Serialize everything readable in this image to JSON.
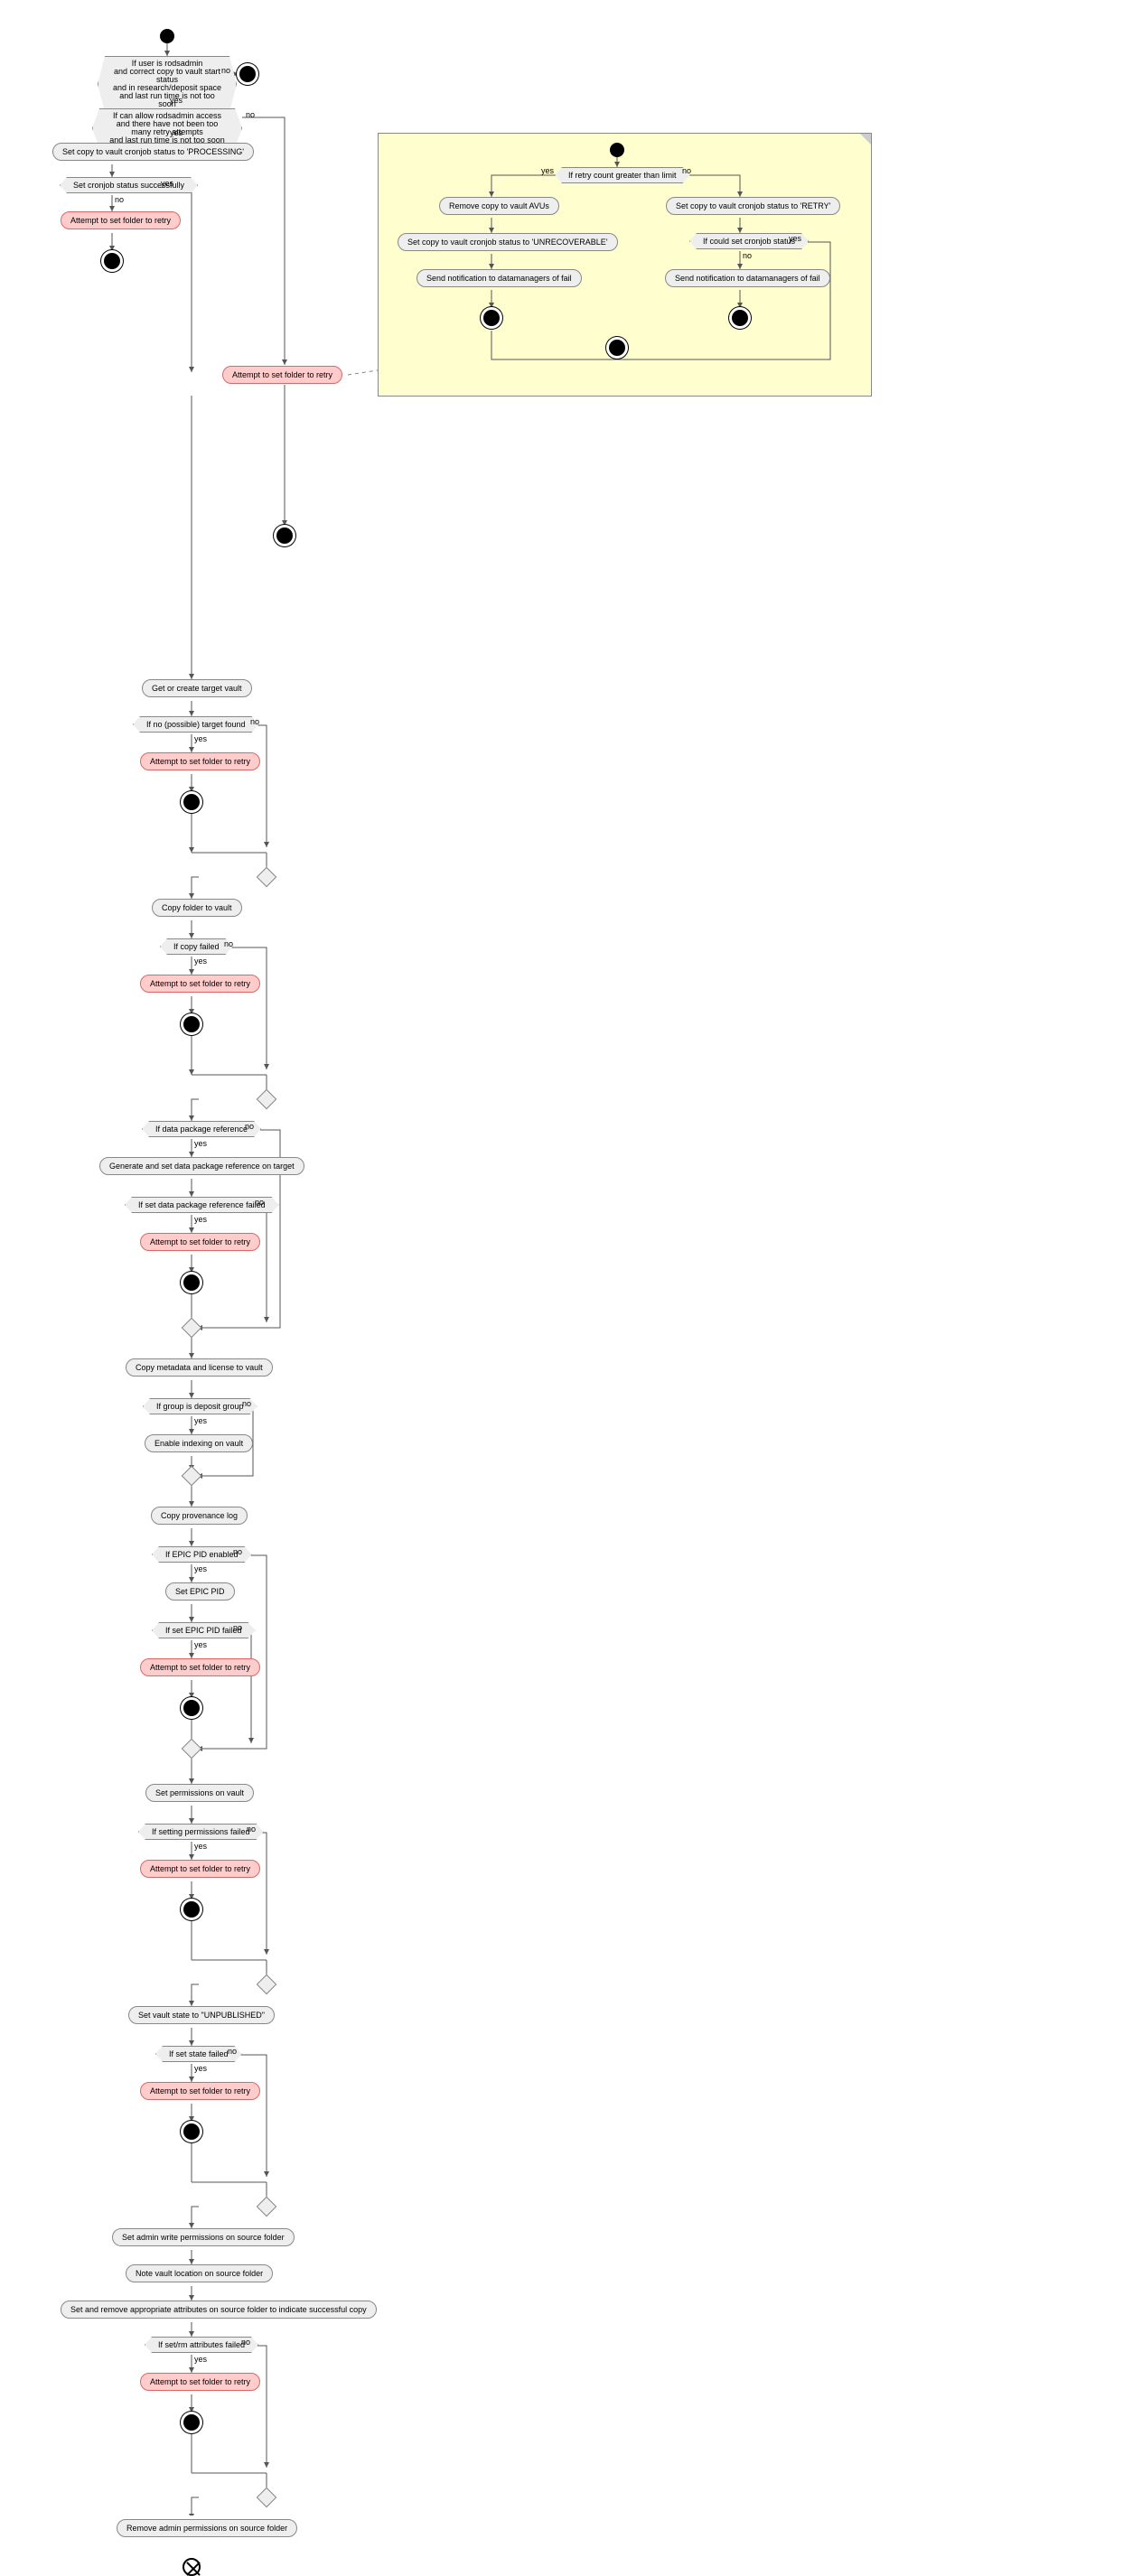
{
  "main": {
    "decision1": "If user is rodsadmin\nand correct copy to vault start status\nand in research/deposit space\nand last run time is not too soon",
    "decision2": "If can allow rodsadmin access\nand there have not been too many retry attempts\nand last run time is not too soon",
    "set_processing": "Set copy to vault cronjob status to 'PROCESSING'",
    "set_success": "Set cronjob status successfully",
    "retry1": "Attempt to set folder to retry",
    "retry_side": "Attempt to set folder to retry",
    "get_target": "Get or create target vault",
    "no_target": "If no (possible) target found",
    "retry2": "Attempt to set folder to retry",
    "copy_folder": "Copy folder to vault",
    "copy_failed": "If copy failed",
    "retry3": "Attempt to set folder to retry",
    "data_pkg_ref": "If data package reference",
    "gen_ref": "Generate and set data package reference on target",
    "set_ref_failed": "If set data package reference failed",
    "retry4": "Attempt to set folder to retry",
    "copy_meta": "Copy metadata and license to vault",
    "deposit_group": "If group is deposit group",
    "enable_index": "Enable indexing on vault",
    "copy_prov": "Copy provenance log",
    "epic_enabled": "If EPIC PID enabled",
    "set_epic": "Set EPIC PID",
    "epic_failed": "If set EPIC PID failed",
    "retry5": "Attempt to set folder to retry",
    "set_perms": "Set permissions on vault",
    "perms_failed": "If setting permissions failed",
    "retry6": "Attempt to set folder to retry",
    "set_unpub": "Set vault state to \"UNPUBLISHED\"",
    "state_failed": "If set state failed",
    "retry7": "Attempt to set folder to retry",
    "admin_write": "Set admin write permissions on source folder",
    "note_loc": "Note vault location on source folder",
    "set_attrs": "Set and remove appropriate attributes on source folder to indicate successful copy",
    "attrs_failed": "If set/rm attributes failed",
    "retry8": "Attempt to set folder to retry",
    "remove_admin": "Remove admin permissions on source folder"
  },
  "note": {
    "retry_limit": "If retry count greater than limit",
    "remove_avus": "Remove copy to vault AVUs",
    "set_unrec": "Set copy to vault cronjob status to 'UNRECOVERABLE'",
    "notify1": "Send notification to datamanagers of fail",
    "set_retry": "Set copy to vault cronjob status to 'RETRY'",
    "could_set": "If could set cronjob status",
    "notify2": "Send notification to datamanagers of fail"
  },
  "labels": {
    "yes": "yes",
    "no": "no"
  }
}
